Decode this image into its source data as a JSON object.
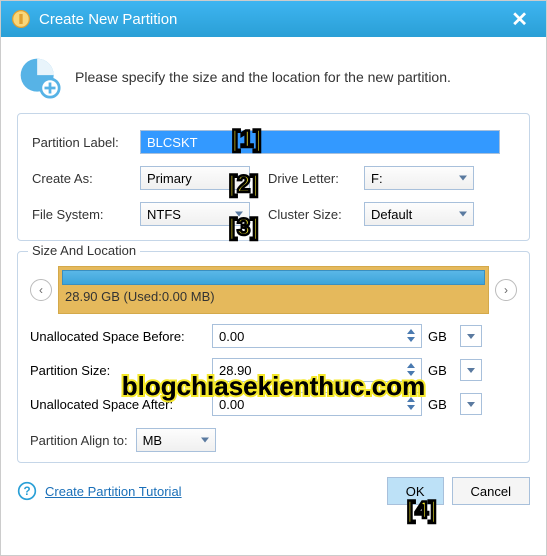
{
  "titlebar": {
    "title": "Create New Partition"
  },
  "info": {
    "text": "Please specify the size and the location for the new partition."
  },
  "form": {
    "partition_label_lbl": "Partition Label:",
    "partition_label_val": "BLCSKT",
    "create_as_lbl": "Create As:",
    "create_as_val": "Primary",
    "drive_letter_lbl": "Drive Letter:",
    "drive_letter_val": "F:",
    "file_system_lbl": "File System:",
    "file_system_val": "NTFS",
    "cluster_size_lbl": "Cluster Size:",
    "cluster_size_val": "Default"
  },
  "size_loc": {
    "legend": "Size And Location",
    "bar_text": "28.90 GB (Used:0.00 MB)",
    "before_lbl": "Unallocated Space Before:",
    "before_val": "0.00",
    "psize_lbl": "Partition Size:",
    "psize_val": "28.90",
    "after_lbl": "Unallocated Space After:",
    "after_val": "0.00",
    "unit": "GB",
    "align_lbl": "Partition Align to:",
    "align_val": "MB"
  },
  "bottom": {
    "tutorial": "Create Partition Tutorial",
    "ok": "OK",
    "cancel": "Cancel"
  },
  "markers": {
    "m1": "[1]",
    "m2": "[2]",
    "m3": "[3]",
    "m4": "[4]"
  },
  "watermark": "blogchiasekienthuc.com"
}
